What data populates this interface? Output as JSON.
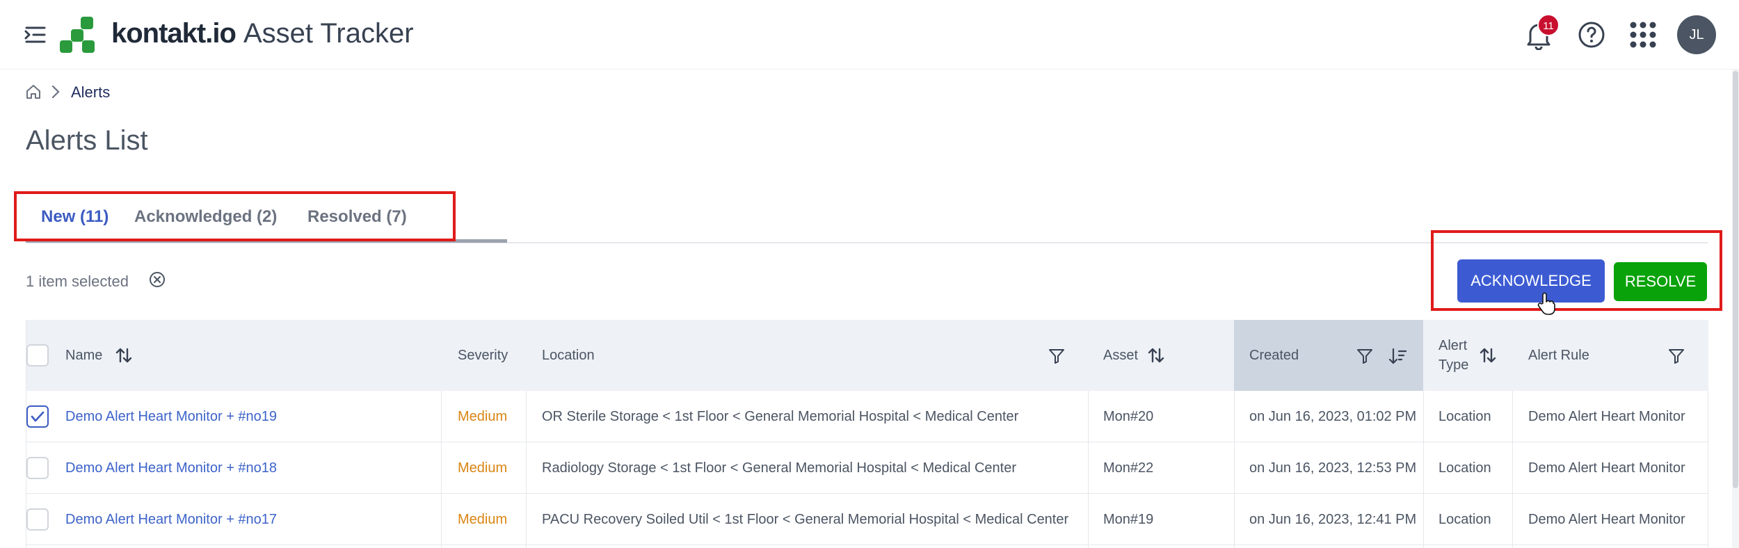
{
  "header": {
    "brand": "kontakt.io",
    "app_name": "Asset Tracker",
    "notification_count": "11",
    "avatar_initials": "JL"
  },
  "breadcrumb": {
    "current": "Alerts"
  },
  "page_title": "Alerts List",
  "tabs": [
    {
      "label": "New (11)",
      "active": true
    },
    {
      "label": "Acknowledged (2)",
      "active": false
    },
    {
      "label": "Resolved (7)",
      "active": false
    }
  ],
  "selection": {
    "text": "1 item selected"
  },
  "actions": {
    "acknowledge_label": "ACKNOWLEDGE",
    "resolve_label": "RESOLVE"
  },
  "table": {
    "columns": {
      "name": "Name",
      "severity": "Severity",
      "location": "Location",
      "asset": "Asset",
      "created": "Created",
      "alert_type_1": "Alert",
      "alert_type_2": "Type",
      "alert_rule": "Alert Rule"
    },
    "rows": [
      {
        "name": "Demo Alert Heart Monitor + #no19",
        "severity": "Medium",
        "location": "OR Sterile Storage < 1st Floor < General Memorial Hospital < Medical Center",
        "asset": "Mon#20",
        "created": "on Jun 16, 2023, 01:02 PM",
        "alert_type": "Location",
        "alert_rule": "Demo Alert Heart Monitor",
        "selected": true
      },
      {
        "name": "Demo Alert Heart Monitor + #no18",
        "severity": "Medium",
        "location": "Radiology Storage < 1st Floor < General Memorial Hospital < Medical Center",
        "asset": "Mon#22",
        "created": "on Jun 16, 2023, 12:53 PM",
        "alert_type": "Location",
        "alert_rule": "Demo Alert Heart Monitor",
        "selected": false
      },
      {
        "name": "Demo Alert Heart Monitor + #no17",
        "severity": "Medium",
        "location": "PACU Recovery Soiled Util < 1st Floor < General Memorial Hospital < Medical Center",
        "asset": "Mon#19",
        "created": "on Jun 16, 2023, 12:41 PM",
        "alert_type": "Location",
        "alert_rule": "Demo Alert Heart Monitor",
        "selected": false
      }
    ]
  },
  "colors": {
    "primary": "#3c5bd3",
    "resolve": "#09a20a",
    "severity_medium": "#d98513",
    "badge": "#c8102e",
    "highlight": "#e01b1b"
  }
}
